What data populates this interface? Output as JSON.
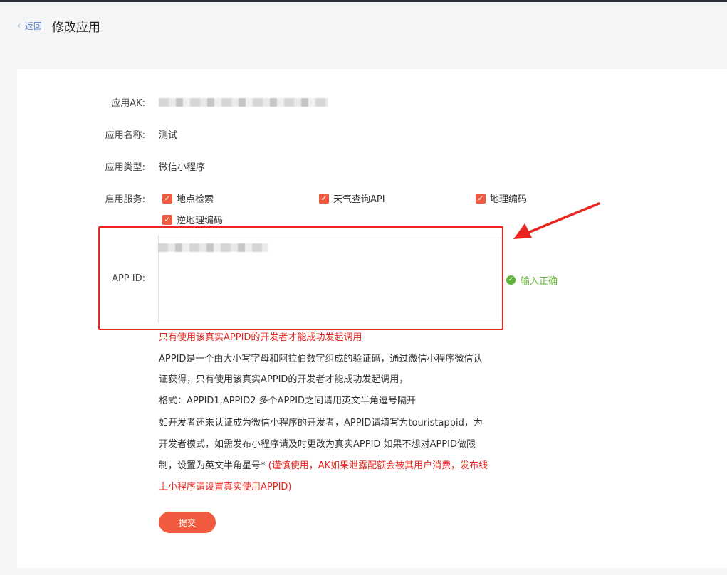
{
  "header": {
    "back_label": "返回",
    "title": "修改应用"
  },
  "form": {
    "ak": {
      "label": "应用AK:"
    },
    "name": {
      "label": "应用名称:",
      "value": "测试"
    },
    "type": {
      "label": "应用类型:",
      "value": "微信小程序"
    },
    "services": {
      "label": "启用服务:",
      "items": [
        {
          "label": "地点检索",
          "checked": true
        },
        {
          "label": "天气查询API",
          "checked": true
        },
        {
          "label": "地理编码",
          "checked": true
        },
        {
          "label": "逆地理编码",
          "checked": true
        }
      ]
    },
    "appid": {
      "label": "APP ID:",
      "status": "输入正确"
    }
  },
  "help": {
    "warning": "只有使用该真实APPID的开发者才能成功发起调用",
    "line1": "APPID是一个由大小写字母和阿拉伯数字组成的验证码，通过微信小程序微信认",
    "line2": "证获得，只有使用该真实APPID的开发者才能成功发起调用，",
    "line3": "格式：APPID1,APPID2 多个APPID之间请用英文半角逗号隔开",
    "line4": "如开发者还未认证成为微信小程序的开发者，APPID请填写为touristappid，为",
    "line5": "开发者模式，如需发布小程序请及时更改为真实APPID 如果不想对APPID做限",
    "line6_black": "制，设置为英文半角星号* ",
    "line6_red": "(谨慎使用，AK如果泄露配额会被其用户消费，发布线",
    "line7_red": "上小程序请设置真实使用APPID)"
  },
  "submit_label": "提交",
  "colors": {
    "accent": "#f05a3e",
    "annotation": "#e8251f",
    "success": "#5cb338"
  }
}
